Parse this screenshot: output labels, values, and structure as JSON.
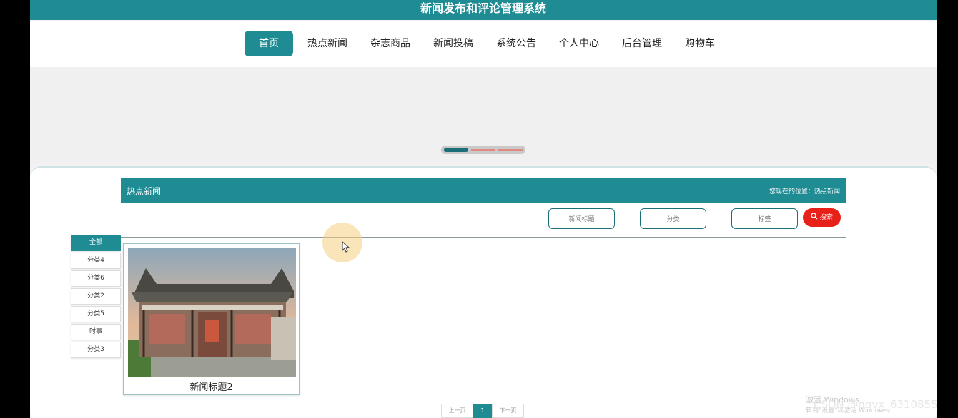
{
  "app": {
    "title": "新闻发布和评论管理系统"
  },
  "nav": {
    "items": [
      {
        "label": "首页",
        "active": true
      },
      {
        "label": "热点新闻",
        "active": false
      },
      {
        "label": "杂志商品",
        "active": false
      },
      {
        "label": "新闻投稿",
        "active": false
      },
      {
        "label": "系统公告",
        "active": false
      },
      {
        "label": "个人中心",
        "active": false
      },
      {
        "label": "后台管理",
        "active": false
      },
      {
        "label": "购物车",
        "active": false
      }
    ]
  },
  "banner": {
    "indicator_count": 3,
    "active_index": 0
  },
  "section": {
    "title": "热点新闻",
    "breadcrumb": "您现在的位置：热点新闻"
  },
  "filters": {
    "title_placeholder": "新闻标题",
    "category_placeholder": "分类",
    "tag_placeholder": "标签",
    "search_label": "搜索",
    "search_icon": "search-icon"
  },
  "categories": [
    "全部",
    "分类4",
    "分类6",
    "分类2",
    "分类5",
    "时事",
    "分类3"
  ],
  "news": [
    {
      "title": "新闻标题2",
      "image": "traditional-chinese-building-photo"
    }
  ],
  "pagination": {
    "prev": "上一页",
    "current": "1",
    "next": "下一页"
  },
  "watermarks": {
    "windows": "激活 Windows",
    "windows_sub": "转到\"设置\"以激活 Windows。",
    "csdn": "CSDN @qqvx_6310855"
  },
  "colors": {
    "accent": "#1f8b93",
    "search_button": "#e8201a"
  }
}
